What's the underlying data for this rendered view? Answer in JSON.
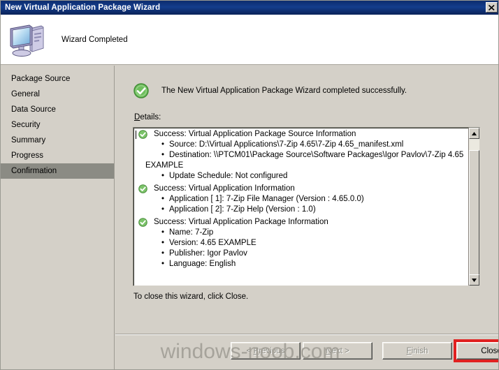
{
  "window": {
    "title": "New Virtual Application Package Wizard",
    "close_icon": "close-x-icon"
  },
  "header": {
    "heading": "Wizard Completed",
    "icon": "computer-monitor-icon"
  },
  "sidebar": {
    "items": [
      {
        "label": "Package Source",
        "active": false
      },
      {
        "label": "General",
        "active": false
      },
      {
        "label": "Data Source",
        "active": false
      },
      {
        "label": "Security",
        "active": false
      },
      {
        "label": "Summary",
        "active": false
      },
      {
        "label": "Progress",
        "active": false
      },
      {
        "label": "Confirmation",
        "active": true
      }
    ]
  },
  "main": {
    "status_icon": "green-check-circle-icon",
    "status_text": "The New Virtual Application Package Wizard completed successfully.",
    "details_label_accel": "D",
    "details_label_rest": "etails:",
    "closing_note": "To close this wizard, click Close.",
    "details": [
      {
        "icon": "green-check-small-icon",
        "heading": "Success: Virtual Application Package Source Information",
        "bullets": [
          {
            "text": "Source: D:\\Virtual Applications\\7-Zip 4.65\\7-Zip 4.65_manifest.xml",
            "wrap": false
          },
          {
            "text": "Destination: \\\\PTCM01\\Package Source\\Software Packages\\Igor Pavlov\\7-Zip 4.65",
            "wrap": false
          },
          {
            "text": "EXAMPLE",
            "wrap": true
          },
          {
            "text": "Update Schedule: Not configured",
            "wrap": false
          }
        ]
      },
      {
        "icon": "green-check-small-icon",
        "heading": "Success: Virtual Application Information",
        "bullets": [
          {
            "text": "Application [  1]: 7-Zip File Manager (Version : 4.65.0.0)",
            "wrap": false
          },
          {
            "text": "Application [  2]: 7-Zip Help (Version : 1.0)",
            "wrap": false
          }
        ]
      },
      {
        "icon": "green-check-small-icon",
        "heading": "Success: Virtual Application Package Information",
        "bullets": [
          {
            "text": "Name: 7-Zip",
            "wrap": false
          },
          {
            "text": "Version: 4.65 EXAMPLE",
            "wrap": false
          },
          {
            "text": "Publisher: Igor Pavlov",
            "wrap": false
          },
          {
            "text": "Language: English",
            "wrap": false
          }
        ]
      }
    ]
  },
  "scrollbar": {
    "up_icon": "scroll-up-arrow-icon",
    "down_icon": "scroll-down-arrow-icon"
  },
  "buttons": {
    "previous": {
      "prefix": "< ",
      "accel": "P",
      "suffix": "revious",
      "disabled": true
    },
    "next": {
      "prefix": "",
      "accel": "N",
      "suffix": "ext >",
      "disabled": true
    },
    "finish": {
      "prefix": "",
      "accel": "F",
      "suffix": "inish",
      "disabled": true
    },
    "close": {
      "label": "Close",
      "disabled": false,
      "highlight_color": "#e02020"
    }
  },
  "watermark": {
    "text": "windows-noob.com"
  }
}
